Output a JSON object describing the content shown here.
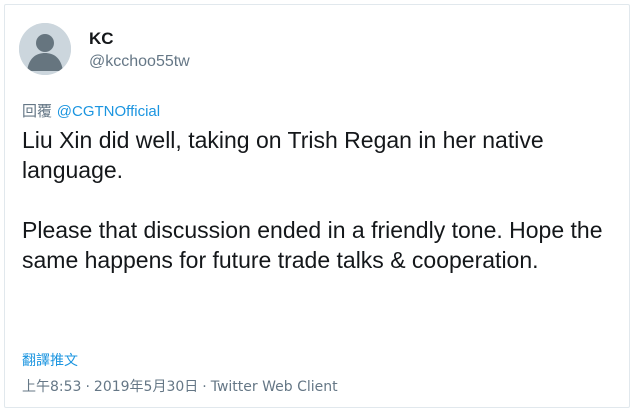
{
  "user": {
    "display_name": "KC",
    "handle": "@kcchoo55tw",
    "avatar_icon": "default-avatar-icon"
  },
  "reply": {
    "prefix": "回覆",
    "mention": "@CGTNOfficial"
  },
  "tweet": {
    "paragraphs": [
      "Liu Xin did well, taking on Trish Regan in her native language.",
      "Please that discussion ended in a friendly tone. Hope the same happens for future trade talks & cooperation."
    ]
  },
  "translate_label": "翻譯推文",
  "meta": {
    "time": "上午8:53",
    "date": "2019年5月30日",
    "separator": "·",
    "client": "Twitter Web Client"
  },
  "colors": {
    "link": "#1b95e0",
    "secondary_text": "#657786",
    "primary_text": "#14171a",
    "border": "#e1e8ed"
  }
}
